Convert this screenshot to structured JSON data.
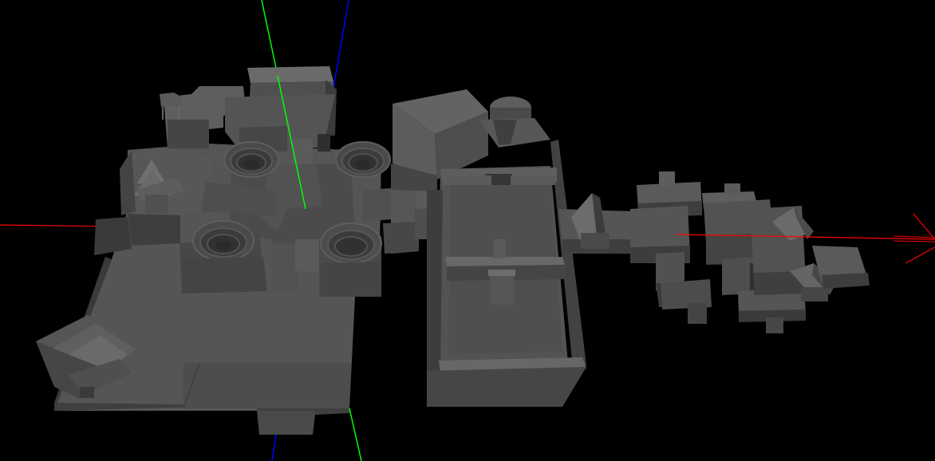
{
  "viewport": {
    "background": "#000000",
    "axis_colors": {
      "x": "#ff0000",
      "y": "#00ff00",
      "z": "#0000ff"
    },
    "mesh_colors": {
      "top": "#555555",
      "side_light": "#5c5c5c",
      "side_mid": "#474747",
      "side_dark": "#393939",
      "edge": "#2b2b2b"
    }
  }
}
